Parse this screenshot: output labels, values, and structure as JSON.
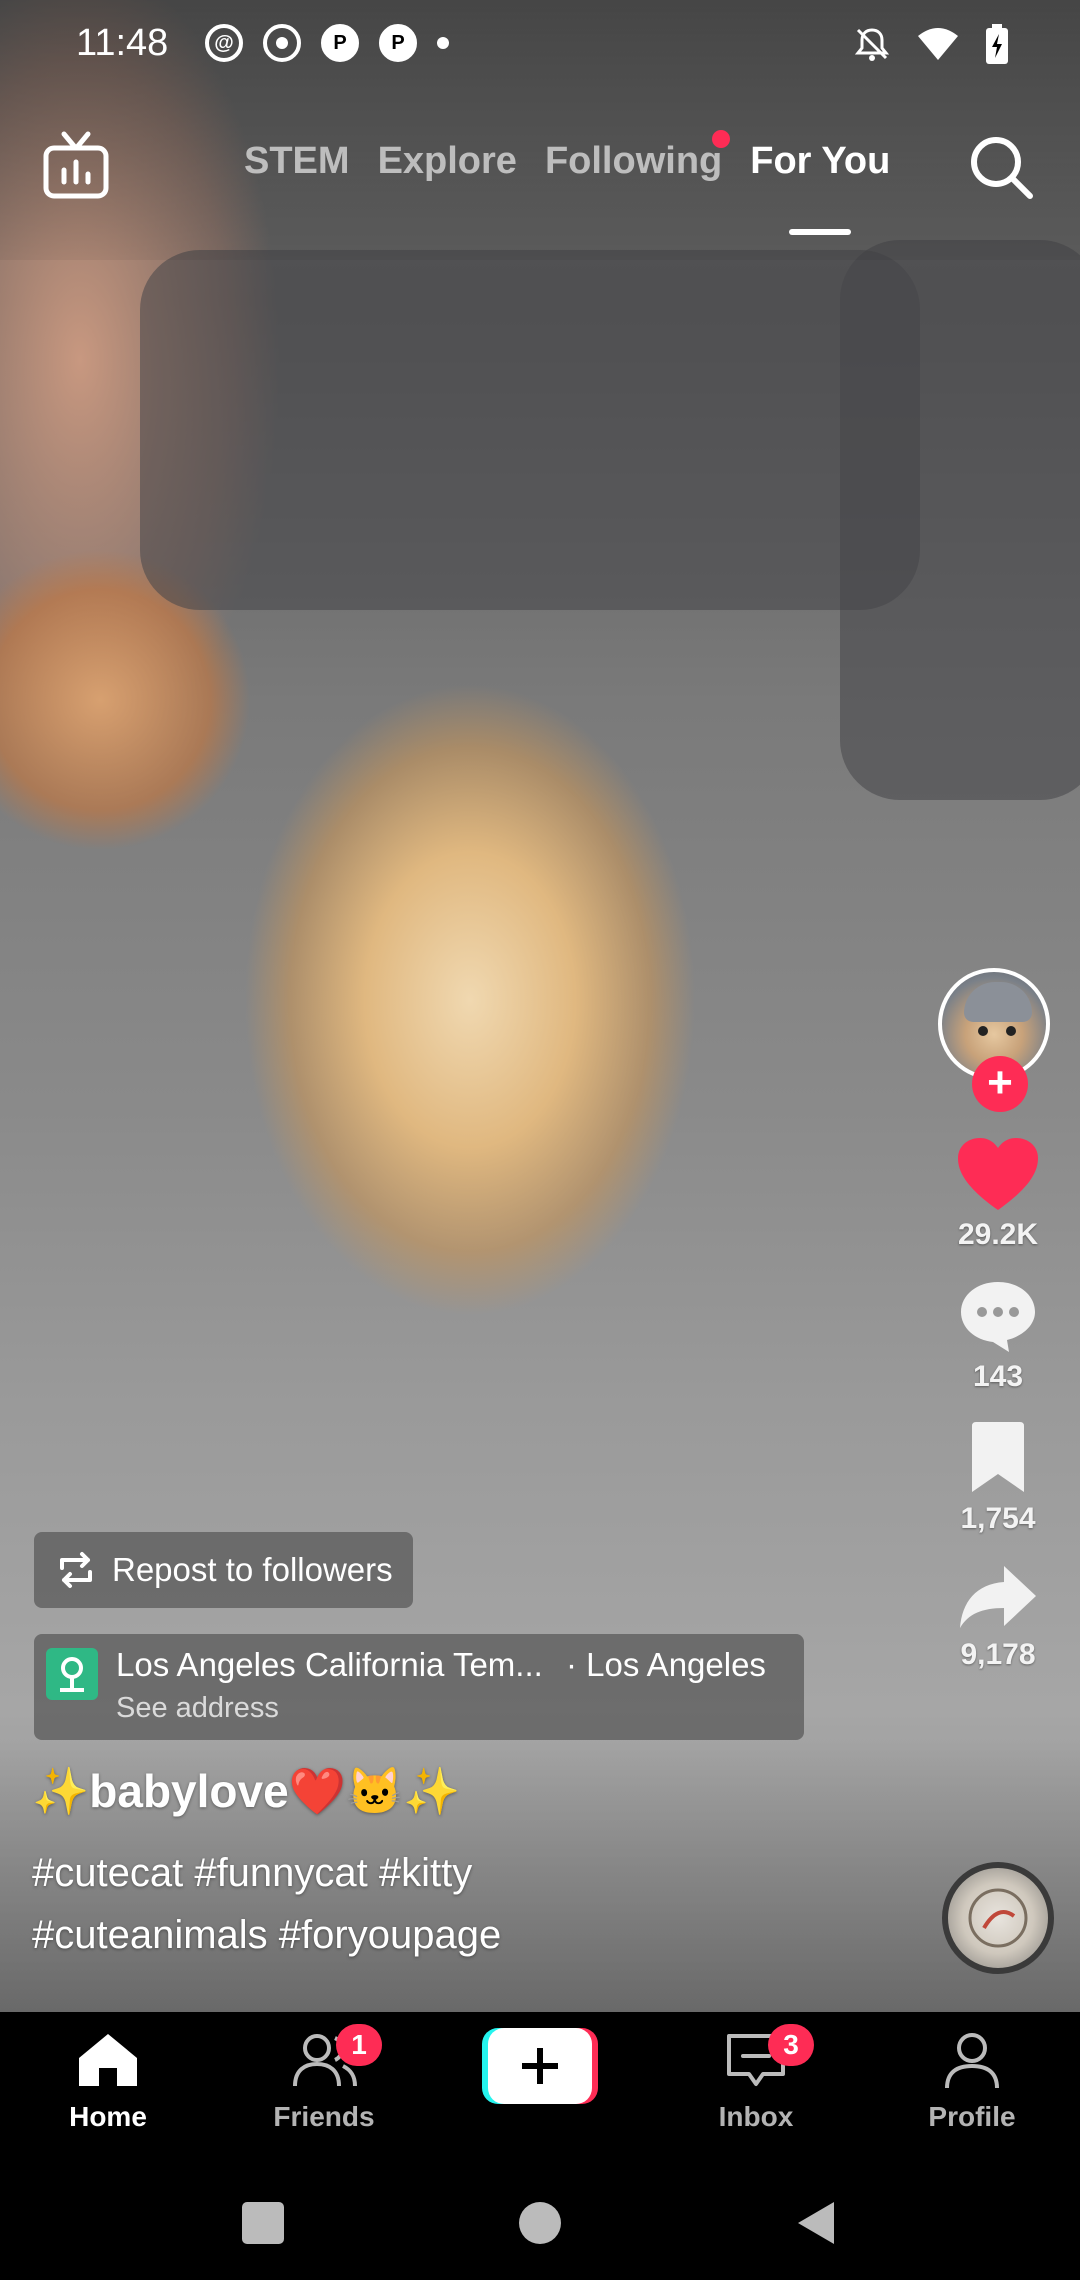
{
  "status_bar": {
    "time": "11:48",
    "notification_icons": [
      "threads-icon",
      "record-icon",
      "pinterest-icon",
      "pinterest-icon",
      "dot"
    ],
    "system_icons": [
      "mute-icon",
      "wifi-icon",
      "battery-charging-icon"
    ]
  },
  "top_nav": {
    "tabs": [
      {
        "label": "STEM",
        "active": false
      },
      {
        "label": "Explore",
        "active": false
      },
      {
        "label": "Following",
        "active": false,
        "has_dot": true
      },
      {
        "label": "For You",
        "active": true
      }
    ]
  },
  "rail": {
    "likes": "29.2K",
    "comments": "143",
    "saves": "1,754",
    "shares": "9,178",
    "follow_symbol": "+"
  },
  "overlays": {
    "repost_label": "Repost to followers",
    "location_name": "Los Angeles California Tem...",
    "location_city": "· Los Angeles",
    "location_sub": "See address"
  },
  "caption": {
    "user": "✨babylove❤️🐱✨",
    "description": "#cutecat #funnycat #kitty #cuteanimals #foryoupage"
  },
  "bottom_nav": {
    "items": [
      {
        "label": "Home",
        "active": true
      },
      {
        "label": "Friends",
        "badge": "1"
      },
      {
        "label": "Inbox",
        "badge": "3"
      },
      {
        "label": "Profile"
      }
    ],
    "create_symbol": "+"
  },
  "colors": {
    "accent": "#fe2c55",
    "location_green": "#2fb885"
  }
}
